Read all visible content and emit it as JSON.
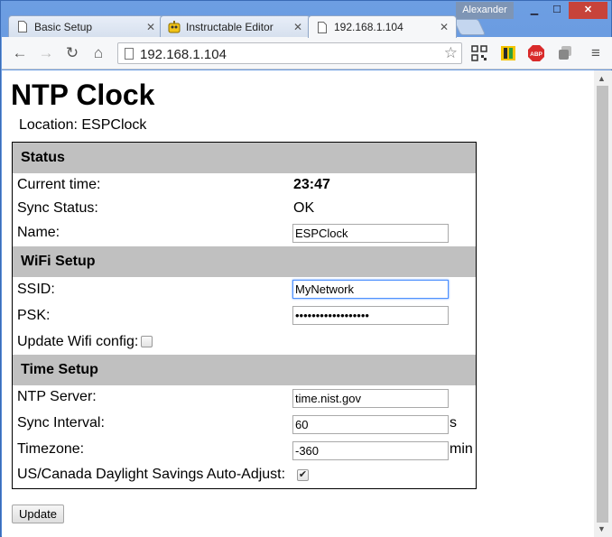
{
  "browser": {
    "tabs": [
      {
        "title": "Basic Setup",
        "icon": "page-icon"
      },
      {
        "title": "Instructable Editor",
        "icon": "robot-icon"
      },
      {
        "title": "192.168.1.104",
        "icon": "page-icon",
        "active": true
      }
    ],
    "user": "Alexander",
    "url": "192.168.1.104",
    "extensions": [
      "qr-code-icon",
      "bookmark-extension-icon",
      "adblock-icon",
      "copy-icon"
    ]
  },
  "page": {
    "title": "NTP Clock",
    "location_label": "Location: ESPClock",
    "sections": {
      "status": {
        "heading": "Status",
        "current_time_label": "Current time:",
        "current_time": "23:47",
        "sync_status_label": "Sync Status:",
        "sync_status": "OK",
        "name_label": "Name:",
        "name_value": "ESPClock"
      },
      "wifi": {
        "heading": "WiFi Setup",
        "ssid_label": "SSID:",
        "ssid_value": "MyNetwork",
        "psk_label": "PSK:",
        "psk_value": "••••••••••••••••••",
        "update_label": "Update Wifi config:",
        "update_checked": false
      },
      "time": {
        "heading": "Time Setup",
        "ntp_label": "NTP Server:",
        "ntp_value": "time.nist.gov",
        "interval_label": "Sync Interval:",
        "interval_value": "60",
        "interval_unit": "s",
        "tz_label": "Timezone:",
        "tz_value": "-360",
        "tz_unit": "min",
        "dst_label": "US/Canada Daylight Savings Auto-Adjust:",
        "dst_checked": true
      }
    },
    "submit_label": "Update"
  }
}
